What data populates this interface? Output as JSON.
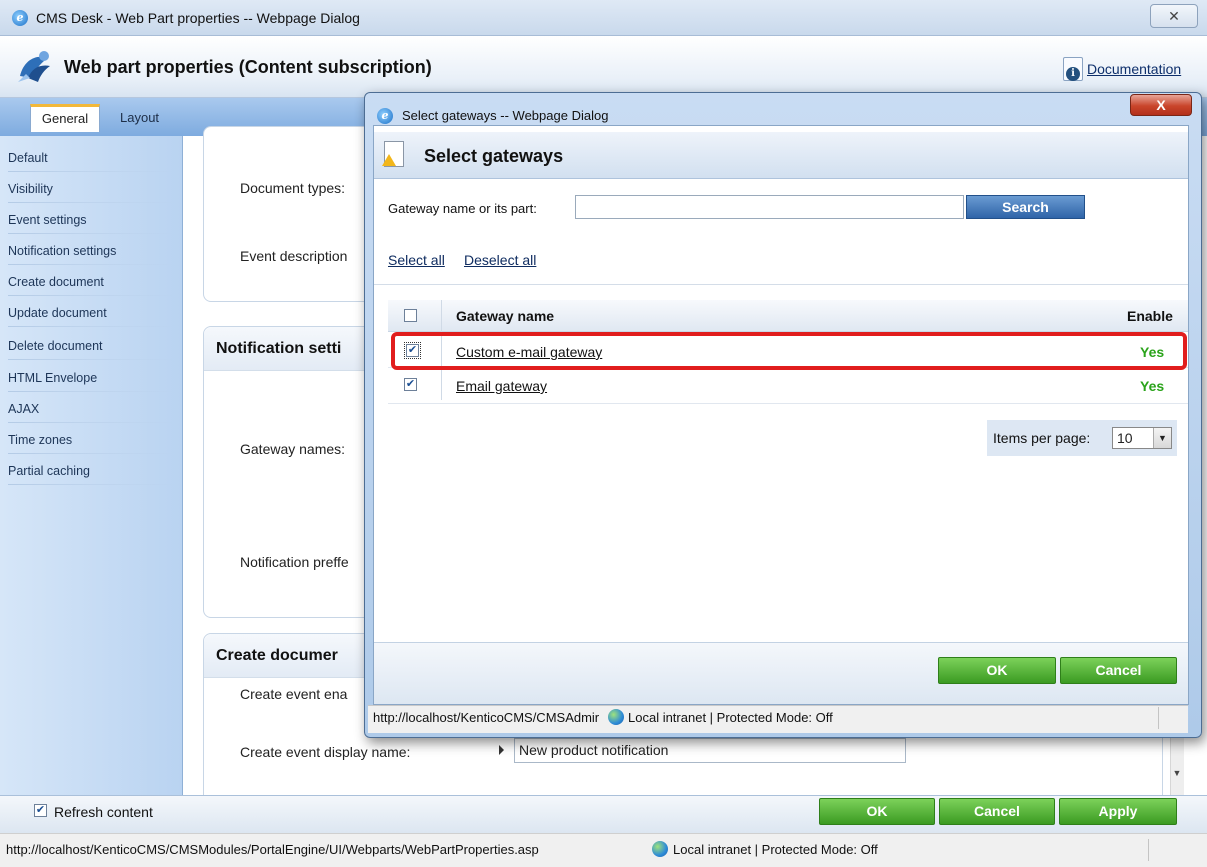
{
  "window": {
    "title": "CMS Desk - Web Part properties -- Webpage Dialog",
    "close_label": "✕"
  },
  "header": {
    "title": "Web part properties (Content subscription)",
    "documentation_link": "Documentation"
  },
  "tabs": [
    {
      "label": "General",
      "active": true
    },
    {
      "label": "Layout",
      "active": false
    }
  ],
  "sidebar": {
    "items": [
      {
        "label": "Default"
      },
      {
        "label": "Visibility"
      },
      {
        "label": "Event settings"
      },
      {
        "label": "Notification settings"
      },
      {
        "label": "Create document"
      },
      {
        "label": "Update document"
      },
      {
        "label": "Delete document"
      },
      {
        "label": "HTML Envelope"
      },
      {
        "label": "AJAX"
      },
      {
        "label": "Time zones"
      },
      {
        "label": "Partial caching"
      }
    ]
  },
  "form": {
    "document_types_label": "Document types:",
    "event_description_label": "Event description",
    "notification_section_title": "Notification setti",
    "gateway_names_label": "Gateway names:",
    "notification_preffered_label": "Notification preffe",
    "create_section_title": "Create documer",
    "create_event_enabled_label": "Create event ena",
    "create_event_display_name_label": "Create event display name:",
    "create_event_display_name_value": "New product notification"
  },
  "bottom": {
    "refresh_label": "Refresh content",
    "refresh_checked": true,
    "ok_label": "OK",
    "cancel_label": "Cancel",
    "apply_label": "Apply"
  },
  "status_bar": {
    "url": "http://localhost/KenticoCMS/CMSModules/PortalEngine/UI/Webparts/WebPartProperties.asp",
    "zone": "Local intranet | Protected Mode: Off"
  },
  "dialog": {
    "title": "Select gateways -- Webpage Dialog",
    "close_label": "X",
    "header_title": "Select gateways",
    "search_label": "Gateway name or its part:",
    "search_value": "",
    "search_button": "Search",
    "select_all": "Select all",
    "deselect_all": "Deselect all",
    "grid": {
      "columns": [
        "Gateway name",
        "Enable"
      ],
      "rows": [
        {
          "name": "Custom e-mail gateway",
          "enabled": "Yes",
          "checked": true
        },
        {
          "name": "Email gateway",
          "enabled": "Yes",
          "checked": true
        }
      ]
    },
    "items_per_page_label": "Items per page:",
    "items_per_page_value": "10",
    "ok_label": "OK",
    "cancel_label": "Cancel",
    "status_url": "http://localhost/KenticoCMS/CMSAdmir",
    "status_zone": "Local intranet | Protected Mode: Off"
  },
  "colors": {
    "accent_green": "#3b9b22",
    "highlight_red": "#e11d1d",
    "enabled_text": "#2aa31a",
    "search_blue": "#2f64a8"
  },
  "icons": [
    "ie-icon",
    "app-logo-icon",
    "documentation-icon",
    "globe-icon",
    "checkbox-icon",
    "warning-icon",
    "dropdown-arrow-icon"
  ]
}
